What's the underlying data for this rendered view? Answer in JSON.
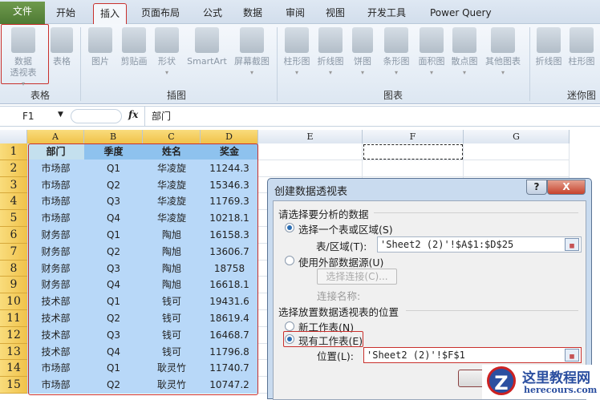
{
  "tabs": [
    "文件",
    "开始",
    "插入",
    "页面布局",
    "公式",
    "数据",
    "审阅",
    "视图",
    "开发工具",
    "Power Query"
  ],
  "ribbon": {
    "buttons": [
      {
        "l1": "数据",
        "l2": "透视表",
        "arrow": true
      },
      {
        "l1": "表格",
        "l2": ""
      },
      {
        "l1": "图片",
        "l2": ""
      },
      {
        "l1": "剪贴画",
        "l2": ""
      },
      {
        "l1": "形状",
        "l2": "",
        "arrow": true
      },
      {
        "l1": "SmartArt",
        "l2": ""
      },
      {
        "l1": "屏幕截图",
        "l2": "",
        "arrow": true
      },
      {
        "l1": "柱形图",
        "l2": "",
        "arrow": true
      },
      {
        "l1": "折线图",
        "l2": "",
        "arrow": true
      },
      {
        "l1": "饼图",
        "l2": "",
        "arrow": true
      },
      {
        "l1": "条形图",
        "l2": "",
        "arrow": true
      },
      {
        "l1": "面积图",
        "l2": "",
        "arrow": true
      },
      {
        "l1": "散点图",
        "l2": "",
        "arrow": true
      },
      {
        "l1": "其他图表",
        "l2": "",
        "arrow": true
      },
      {
        "l1": "折线图",
        "l2": ""
      },
      {
        "l1": "柱形图",
        "l2": ""
      }
    ],
    "groups": [
      "表格",
      "插图",
      "图表",
      "迷你图"
    ]
  },
  "formula_bar": {
    "name_box": "F1",
    "fx": "fx",
    "value": "部门"
  },
  "columns": [
    "A",
    "B",
    "C",
    "D",
    "E",
    "F",
    "G"
  ],
  "rows": [
    [
      "部门",
      "季度",
      "姓名",
      "奖金"
    ],
    [
      "市场部",
      "Q1",
      "华凌旋",
      "11244.3"
    ],
    [
      "市场部",
      "Q2",
      "华凌旋",
      "15346.3"
    ],
    [
      "市场部",
      "Q3",
      "华凌旋",
      "11769.3"
    ],
    [
      "市场部",
      "Q4",
      "华凌旋",
      "10218.1"
    ],
    [
      "财务部",
      "Q1",
      "陶旭",
      "16158.3"
    ],
    [
      "财务部",
      "Q2",
      "陶旭",
      "13606.7"
    ],
    [
      "财务部",
      "Q3",
      "陶旭",
      "18758"
    ],
    [
      "财务部",
      "Q4",
      "陶旭",
      "16618.1"
    ],
    [
      "技术部",
      "Q1",
      "钱可",
      "19431.6"
    ],
    [
      "技术部",
      "Q2",
      "钱可",
      "18619.4"
    ],
    [
      "技术部",
      "Q3",
      "钱可",
      "16468.7"
    ],
    [
      "技术部",
      "Q4",
      "钱可",
      "11796.8"
    ],
    [
      "市场部",
      "Q1",
      "耿灵竹",
      "11740.7"
    ],
    [
      "市场部",
      "Q2",
      "耿灵竹",
      "10747.2"
    ]
  ],
  "dialog": {
    "title": "创建数据透视表",
    "help": "?",
    "close": "X",
    "section1": "请选择要分析的数据",
    "opt_range": "选择一个表或区域(S)",
    "range_label": "表/区域(T):",
    "range_value": "'Sheet2 (2)'!$A$1:$D$25",
    "opt_external": "使用外部数据源(U)",
    "choose_conn": "选择连接(C)...",
    "conn_name": "连接名称:",
    "section2": "选择放置数据透视表的位置",
    "opt_new": "新工作表(N)",
    "opt_existing": "现有工作表(E)",
    "loc_label": "位置(L):",
    "loc_value": "'Sheet2 (2)'!$F$1",
    "ok": "确定"
  },
  "watermark": {
    "title": "这里教程网",
    "url": "herecours.com"
  }
}
